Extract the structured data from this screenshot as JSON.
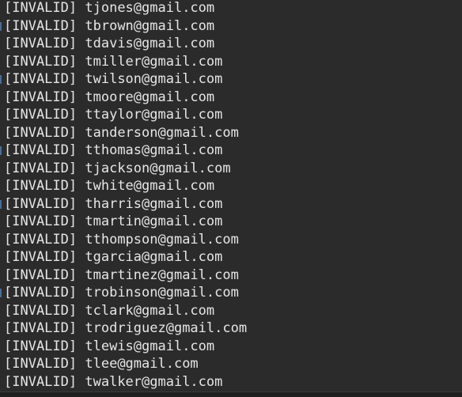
{
  "lines": [
    {
      "status": "[INVALID]",
      "email": "tjones@gmail.com"
    },
    {
      "status": "[INVALID]",
      "email": "tbrown@gmail.com"
    },
    {
      "status": "[INVALID]",
      "email": "tdavis@gmail.com"
    },
    {
      "status": "[INVALID]",
      "email": "tmiller@gmail.com"
    },
    {
      "status": "[INVALID]",
      "email": "twilson@gmail.com"
    },
    {
      "status": "[INVALID]",
      "email": "tmoore@gmail.com"
    },
    {
      "status": "[INVALID]",
      "email": "ttaylor@gmail.com"
    },
    {
      "status": "[INVALID]",
      "email": "tanderson@gmail.com"
    },
    {
      "status": "[INVALID]",
      "email": "tthomas@gmail.com"
    },
    {
      "status": "[INVALID]",
      "email": "tjackson@gmail.com"
    },
    {
      "status": "[INVALID]",
      "email": "twhite@gmail.com"
    },
    {
      "status": "[INVALID]",
      "email": "tharris@gmail.com"
    },
    {
      "status": "[INVALID]",
      "email": "tmartin@gmail.com"
    },
    {
      "status": "[INVALID]",
      "email": "tthompson@gmail.com"
    },
    {
      "status": "[INVALID]",
      "email": "tgarcia@gmail.com"
    },
    {
      "status": "[INVALID]",
      "email": "tmartinez@gmail.com"
    },
    {
      "status": "[INVALID]",
      "email": "trobinson@gmail.com"
    },
    {
      "status": "[INVALID]",
      "email": "tclark@gmail.com"
    },
    {
      "status": "[INVALID]",
      "email": "trodriguez@gmail.com"
    },
    {
      "status": "[INVALID]",
      "email": "tlewis@gmail.com"
    },
    {
      "status": "[INVALID]",
      "email": "tlee@gmail.com"
    },
    {
      "status": "[INVALID]",
      "email": "twalker@gmail.com"
    }
  ]
}
